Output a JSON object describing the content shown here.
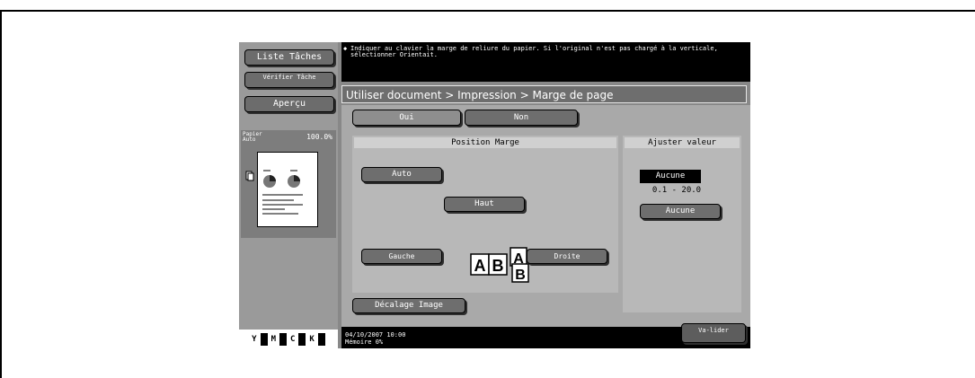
{
  "left": {
    "liste_taches": "Liste Tâches",
    "verifier_tache": "Vérifier Tâche",
    "apercu": "Aperçu",
    "papier": "Papier Auto",
    "zoom": "100.0%",
    "toner": [
      "Y",
      "M",
      "C",
      "K"
    ]
  },
  "message": "Indiquer au clavier la marge de reliure du papier. Si l'original n'est pas chargé à la verticale, sélectionner Orientait.",
  "breadcrumb": "Utiliser document > Impression > Marge de page",
  "toggle": {
    "oui": "Oui",
    "non": "Non"
  },
  "position": {
    "title": "Position Marge",
    "auto": "Auto",
    "haut": "Haut",
    "gauche": "Gauche",
    "droite": "Droite",
    "ab_left": [
      "A",
      "B"
    ],
    "ab_right": [
      "A",
      "B"
    ]
  },
  "ajuster": {
    "title": "Ajuster valeur",
    "value": "Aucune",
    "range": "0.1  -  20.0",
    "button": "Aucune"
  },
  "decalage": "Décalage Image",
  "valider": "Va-lider",
  "status": {
    "datetime": "04/10/2007   10:00",
    "memoire": "Mémoire       0%"
  }
}
